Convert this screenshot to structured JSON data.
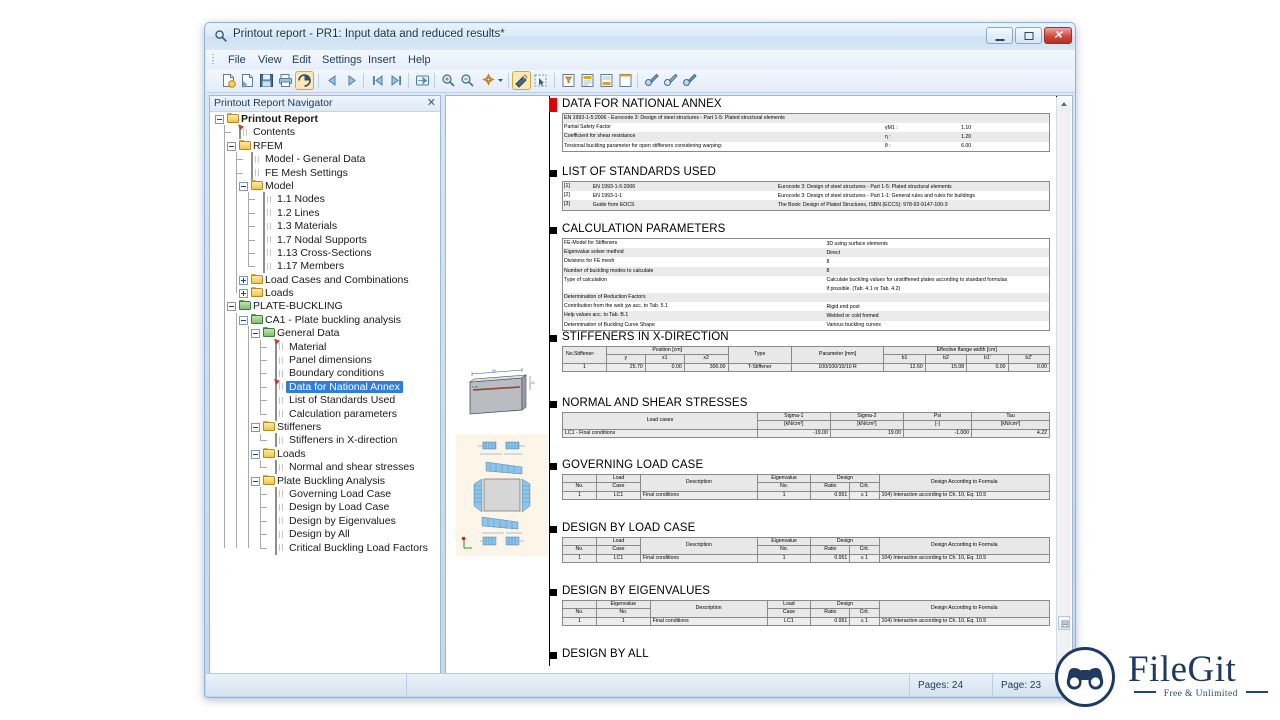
{
  "window": {
    "title": "Printout report - PR1: Input data and reduced results*",
    "title_icon": "magnifier-icon",
    "minimize_label": "",
    "maximize_label": "",
    "close_label": "✕"
  },
  "menu": [
    "File",
    "View",
    "Edit",
    "Settings",
    "Insert",
    "Help"
  ],
  "toolbar": {
    "buttons": [
      {
        "name": "new-report-icon"
      },
      {
        "name": "open-report-icon"
      },
      {
        "name": "save-icon"
      },
      {
        "name": "print-icon"
      },
      {
        "name": "print-preview-icon"
      },
      {
        "name": "previous-page-icon"
      },
      {
        "name": "next-page-icon"
      },
      {
        "name": "first-page-icon"
      },
      {
        "name": "last-page-icon"
      },
      {
        "name": "export-icon"
      },
      {
        "name": "zoom-in-icon"
      },
      {
        "name": "zoom-out-icon"
      },
      {
        "name": "zoom-fit-icon"
      },
      {
        "name": "selection-tool-icon"
      },
      {
        "name": "pointer-tool-icon"
      },
      {
        "name": "filter-icon"
      },
      {
        "name": "page-setup-icon"
      },
      {
        "name": "header-footer-icon"
      },
      {
        "name": "blank-page-icon"
      },
      {
        "name": "settings-key-icon"
      },
      {
        "name": "settings-key2-icon"
      },
      {
        "name": "settings-key3-icon"
      }
    ]
  },
  "navigator": {
    "header": "Printout Report Navigator",
    "close_glyph": "✕",
    "tree": [
      {
        "depth": 0,
        "label": "Printout Report",
        "icon": "folder",
        "toggle": "minus",
        "bold": true
      },
      {
        "depth": 1,
        "label": "Contents",
        "icon": "table-red"
      },
      {
        "depth": 1,
        "label": "RFEM",
        "icon": "folder",
        "toggle": "minus"
      },
      {
        "depth": 2,
        "label": "Model - General Data",
        "icon": "table"
      },
      {
        "depth": 2,
        "label": "FE Mesh Settings",
        "icon": "table"
      },
      {
        "depth": 2,
        "label": "Model",
        "icon": "folder",
        "toggle": "minus"
      },
      {
        "depth": 3,
        "label": "1.1 Nodes",
        "icon": "table"
      },
      {
        "depth": 3,
        "label": "1.2 Lines",
        "icon": "table"
      },
      {
        "depth": 3,
        "label": "1.3 Materials",
        "icon": "table"
      },
      {
        "depth": 3,
        "label": "1.7 Nodal Supports",
        "icon": "table"
      },
      {
        "depth": 3,
        "label": "1.13 Cross-Sections",
        "icon": "table"
      },
      {
        "depth": 3,
        "label": "1.17 Members",
        "icon": "table"
      },
      {
        "depth": 2,
        "label": "Load Cases and Combinations",
        "icon": "folder",
        "toggle": "plus"
      },
      {
        "depth": 2,
        "label": "Loads",
        "icon": "folder",
        "toggle": "plus"
      },
      {
        "depth": 1,
        "label": "PLATE-BUCKLING",
        "icon": "folder-green",
        "toggle": "minus"
      },
      {
        "depth": 2,
        "label": "CA1 - Plate buckling analysis",
        "icon": "folder-green",
        "toggle": "minus"
      },
      {
        "depth": 3,
        "label": "General Data",
        "icon": "folder-green",
        "toggle": "minus"
      },
      {
        "depth": 4,
        "label": "Material",
        "icon": "table-red"
      },
      {
        "depth": 4,
        "label": "Panel dimensions",
        "icon": "table"
      },
      {
        "depth": 4,
        "label": "Boundary conditions",
        "icon": "table"
      },
      {
        "depth": 4,
        "label": "Data for National Annex",
        "icon": "table-red",
        "selected": true
      },
      {
        "depth": 4,
        "label": "List of Standards Used",
        "icon": "table"
      },
      {
        "depth": 4,
        "label": "Calculation parameters",
        "icon": "table"
      },
      {
        "depth": 3,
        "label": "Stiffeners",
        "icon": "folder",
        "toggle": "minus"
      },
      {
        "depth": 4,
        "label": "Stiffeners in X-direction",
        "icon": "table"
      },
      {
        "depth": 3,
        "label": "Loads",
        "icon": "folder",
        "toggle": "minus"
      },
      {
        "depth": 4,
        "label": "Normal and shear stresses",
        "icon": "table"
      },
      {
        "depth": 3,
        "label": "Plate Buckling Analysis",
        "icon": "folder",
        "toggle": "minus"
      },
      {
        "depth": 4,
        "label": "Governing Load Case",
        "icon": "table"
      },
      {
        "depth": 4,
        "label": "Design by Load Case",
        "icon": "table"
      },
      {
        "depth": 4,
        "label": "Design by Eigenvalues",
        "icon": "table"
      },
      {
        "depth": 4,
        "label": "Design by All",
        "icon": "table"
      },
      {
        "depth": 4,
        "label": "Critical Buckling Load Factors",
        "icon": "table"
      }
    ]
  },
  "report": {
    "s1": {
      "title": "DATA FOR NATIONAL ANNEX",
      "standard_line": "EN 1993-1-5:2006 - Eurocode 3: Design of steel structures - Part 1-5: Plated structural elements",
      "rows": [
        {
          "label": "Partial Safety Factor",
          "sym": "γM1 :",
          "value": "1.10"
        },
        {
          "label": "Coefficient for shear resistance",
          "sym": "η :",
          "value": "1.20"
        },
        {
          "label": "Torsional buckling parameter for open stiffeners considering warping:",
          "sym": "θ :",
          "value": "6.00"
        }
      ]
    },
    "s2": {
      "title": "LIST OF STANDARDS USED",
      "rows": [
        {
          "no": "[1]",
          "code": "EN 1993-1-5:2006",
          "desc": "Eurocode 3: Design of steel structures - Part 1-5: Plated structural elements"
        },
        {
          "no": "[2]",
          "code": "EN 1993-1-1",
          "desc": "Eurocode 3: Design of steel structures - Part 1-1: General rules and rules for buildings"
        },
        {
          "no": "[3]",
          "code": "Guide from EOCS",
          "desc": "The Book: Design of Plated Structures, ISBN (ECCS): 978-92-9147-100-3"
        }
      ]
    },
    "s3": {
      "title": "CALCULATION PARAMETERS",
      "rows": [
        {
          "label": "FE-Model for Stiffeners",
          "value": "3D using surface elements"
        },
        {
          "label": "Eigenvalue solver method",
          "value": "Direct"
        },
        {
          "label": "Divisions for FE mesh",
          "value": "8"
        },
        {
          "label": "Number of buckling modes to calculate",
          "value": "8"
        },
        {
          "label": "Type of calculation",
          "value": "Calculate buckling values for unstiffened plates according to standard formulas"
        },
        {
          "label": "",
          "value": "if possible. (Tab. 4.1 or Tab. 4.2)"
        },
        {
          "label": "Determination of Reduction Factors",
          "value": ""
        },
        {
          "label": "Contribution from the web χw acc. to Tab. 5.1",
          "value": "Rigid end post"
        },
        {
          "label": "Help values acc. to Tab. B.1",
          "value": "Welded or cold formed"
        },
        {
          "label": "Determination of Buckling Curve Shape",
          "value": "Various buckling curves"
        }
      ]
    },
    "s4": {
      "title": "STIFFENERS IN X-DIRECTION",
      "headers_top": [
        "Stiffener-",
        "Position [cm]",
        "Type",
        "Parameter [mm]",
        "Effective flange width [cm]"
      ],
      "headers_sub": [
        "No.",
        "y",
        "x1",
        "x2",
        "",
        "",
        "b1",
        "b2",
        "b1'",
        "b2'"
      ],
      "rows": [
        {
          "no": "1",
          "y": "25.70",
          "x1": "0.00",
          "x2": "300.00",
          "type": "T-Stiffener",
          "param": "100/100/10/10 R",
          "b1": "12.60",
          "b2": "15.08",
          "b1p": "0.00",
          "b2p": "0.00"
        }
      ]
    },
    "s5": {
      "title": "NORMAL AND SHEAR STRESSES",
      "headers": [
        "Load cases",
        "Sigma-1",
        "Sigma-2",
        "Psi",
        "Tau"
      ],
      "units": [
        "",
        "[kN/cm²]",
        "[kN/cm²]",
        "[-]",
        "[kN/cm²]"
      ],
      "rows": [
        {
          "lc": "LC1 - Final conditions",
          "s1": "-19.00",
          "s2": "19.00",
          "psi": "-1.000",
          "tau": "4.22"
        }
      ]
    },
    "s6": {
      "title": "GOVERNING LOAD CASE",
      "headers_top": [
        "",
        "Load",
        "",
        "Eigenvalue",
        "Design",
        "",
        ""
      ],
      "headers": [
        "No.",
        "Case",
        "Description",
        "No.",
        "Ratio",
        "Crit.",
        "Design According to Formula"
      ],
      "rows": [
        {
          "no": "1",
          "lc": "LC1",
          "desc": "Final conditions",
          "ev": "1",
          "ratio": "0.951",
          "crit": "≤ 1",
          "formula": "104) Interaction according to Ch. 10, Eq. 10.5"
        }
      ]
    },
    "s7": {
      "title": "DESIGN BY LOAD CASE",
      "headers_top": [
        "",
        "Load",
        "",
        "Eigenvalue",
        "Design",
        "",
        ""
      ],
      "headers": [
        "No.",
        "Case",
        "Description",
        "No.",
        "Ratio",
        "Crit.",
        "Design According to Formula"
      ],
      "rows": [
        {
          "no": "1",
          "lc": "LC1",
          "desc": "Final conditions",
          "ev": "1",
          "ratio": "0.951",
          "crit": "≤ 1",
          "formula": "104) Interaction according to Ch. 10, Eq. 10.5"
        }
      ]
    },
    "s8": {
      "title": "DESIGN BY EIGENVALUES",
      "headers_top": [
        "",
        "Eigenvalue",
        "",
        "Load",
        "Design",
        "",
        ""
      ],
      "headers": [
        "No.",
        "No.",
        "Description",
        "Case",
        "Ratio",
        "Crit.",
        "Design According to Formula"
      ],
      "rows": [
        {
          "no": "1",
          "ev": "1",
          "desc": "Final conditions",
          "lc": "LC1",
          "ratio": "0.951",
          "crit": "≤ 1",
          "formula": "104) Interaction according to Ch. 10, Eq. 10.5"
        }
      ]
    },
    "s9": {
      "title": "DESIGN BY ALL"
    }
  },
  "status": {
    "pages_total": "Pages: 24",
    "page_current": "Page: 23"
  },
  "logo": {
    "name": "FileGit",
    "tagline": "Free & Unlimited"
  },
  "colors": {
    "accent": "#2f7fd8",
    "red_marker": "#e10000",
    "title_text": "#12314f",
    "logo": "#1f3a5f"
  }
}
